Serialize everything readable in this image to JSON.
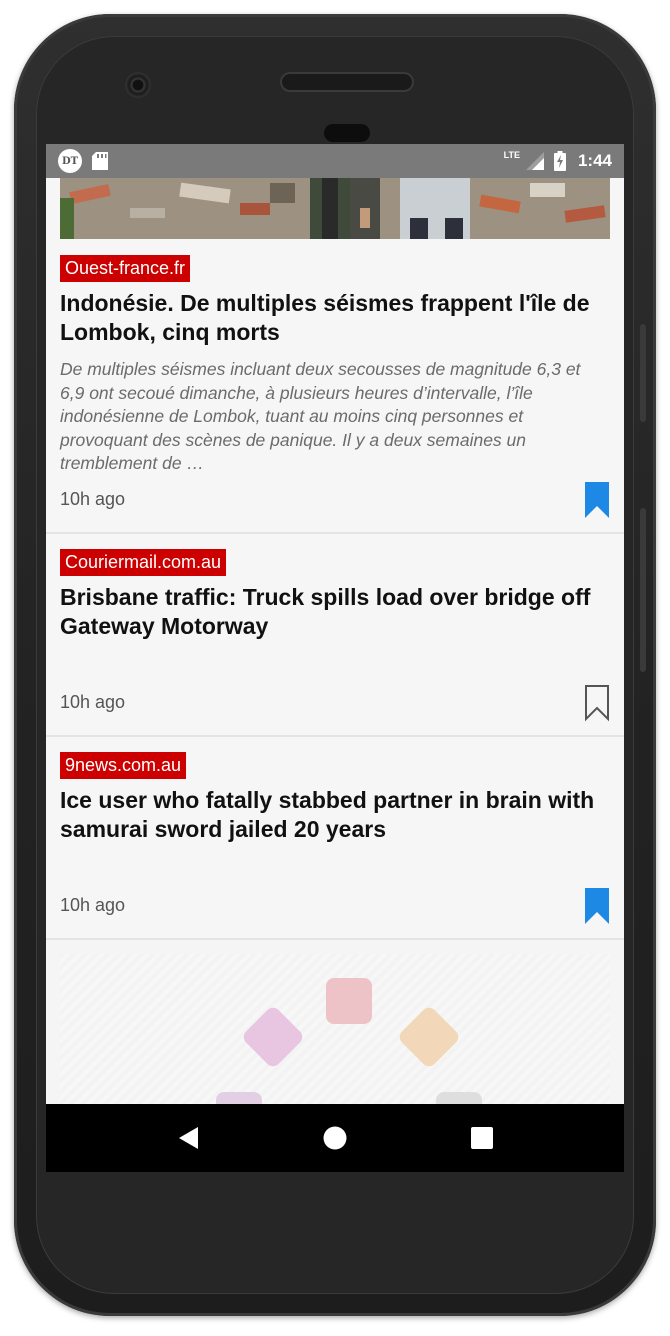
{
  "status_bar": {
    "app_icon_text": "DT",
    "network": "LTE",
    "time": "1:44"
  },
  "articles": [
    {
      "source": "Ouest-france.fr",
      "headline": "Indonésie. De multiples séismes frappent l'île de Lombok, cinq morts",
      "summary": "De multiples séismes incluant deux secousses de magnitude 6,3 et 6,9 ont secoué dimanche, à plusieurs heures d’intervalle, l’île indonésienne de Lombok, tuant au moins cinq personnes et provoquant des scènes de panique. Il y a deux semaines un tremblement de …",
      "time": "10h ago",
      "bookmarked": true
    },
    {
      "source": "Couriermail.com.au",
      "headline": "Brisbane traffic: Truck spills load over bridge off Gateway Motorway",
      "summary": "",
      "time": "10h ago",
      "bookmarked": false
    },
    {
      "source": "9news.com.au",
      "headline": "Ice user who fatally stabbed partner in brain with samurai sword jailed 20 years",
      "summary": "",
      "time": "10h ago",
      "bookmarked": true
    }
  ],
  "colors": {
    "source_badge": "#cc0000",
    "bookmark_active": "#1e88e5",
    "bookmark_inactive": "#555555",
    "status_bar": "#7a7a7a"
  },
  "icons": {
    "status": [
      "dt-app-icon",
      "sd-card-icon",
      "signal-icon",
      "battery-charging-icon"
    ],
    "nav": [
      "back-icon",
      "home-icon",
      "recents-icon"
    ],
    "article": "bookmark-icon"
  }
}
